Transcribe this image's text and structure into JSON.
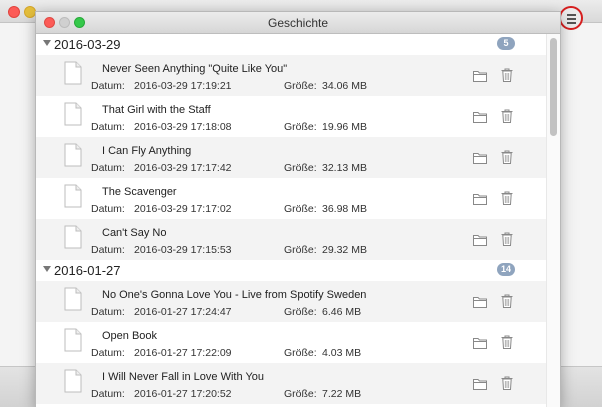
{
  "window": {
    "title": "Geschichte"
  },
  "labels": {
    "date": "Datum:",
    "size": "Größe:"
  },
  "colors": {
    "badge": "#8fa4be",
    "highlight_circle": "#d61f1f"
  },
  "groups": [
    {
      "date": "2016-03-29",
      "count": "5",
      "items": [
        {
          "title": "Never Seen Anything \"Quite Like You\"",
          "datetime": "2016-03-29 17:19:21",
          "size": "34.06 MB"
        },
        {
          "title": "That Girl with the Staff",
          "datetime": "2016-03-29 17:18:08",
          "size": "19.96 MB"
        },
        {
          "title": "I Can Fly Anything",
          "datetime": "2016-03-29 17:17:42",
          "size": "32.13 MB"
        },
        {
          "title": "The Scavenger",
          "datetime": "2016-03-29 17:17:02",
          "size": "36.98 MB"
        },
        {
          "title": "Can't Say No",
          "datetime": "2016-03-29 17:15:53",
          "size": "29.32 MB"
        }
      ]
    },
    {
      "date": "2016-01-27",
      "count": "14",
      "items": [
        {
          "title": "No One's Gonna Love You - Live from Spotify Sweden",
          "datetime": "2016-01-27 17:24:47",
          "size": "6.46 MB"
        },
        {
          "title": "Open Book",
          "datetime": "2016-01-27 17:22:09",
          "size": "4.03 MB"
        },
        {
          "title": "I Will Never Fall in Love With You",
          "datetime": "2016-01-27 17:20:52",
          "size": "7.22 MB"
        }
      ]
    }
  ]
}
